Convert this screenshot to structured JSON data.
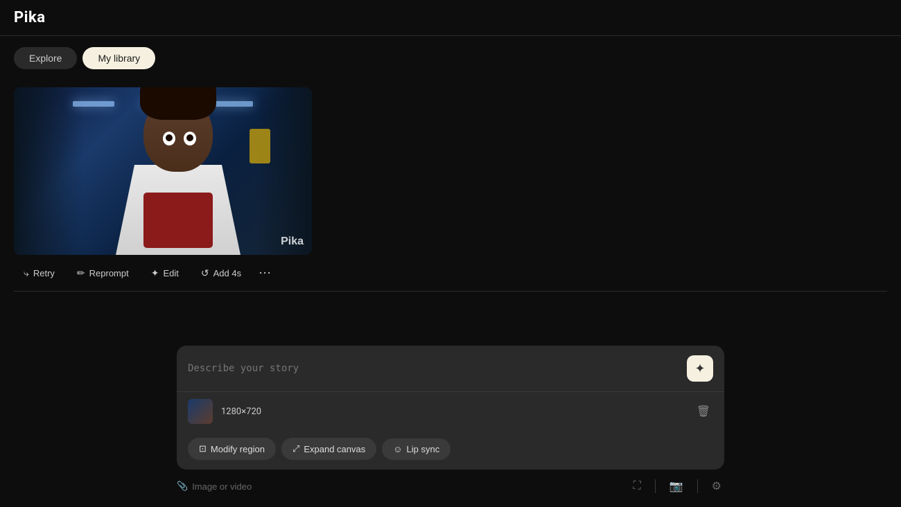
{
  "app": {
    "logo": "Pika"
  },
  "nav": {
    "explore_label": "Explore",
    "library_label": "My library",
    "active_tab": "library"
  },
  "video": {
    "watermark": "Pika",
    "dimensions": "1280×720"
  },
  "action_bar": {
    "retry_label": "Retry",
    "reprompt_label": "Reprompt",
    "edit_label": "Edit",
    "add4s_label": "Add 4s",
    "more_dots": "•••"
  },
  "input": {
    "placeholder": "Describe your story",
    "generate_icon": "✦",
    "image_dims": "1280×720"
  },
  "tools": {
    "modify_region_label": "Modify region",
    "expand_canvas_label": "Expand canvas",
    "lip_sync_label": "Lip sync"
  },
  "footer": {
    "attach_label": "Image or video"
  },
  "icons": {
    "retry": "⤷",
    "reprompt": "✏",
    "edit": "✦",
    "add4s": "↺",
    "more": "⋯",
    "generate": "✦",
    "delete": "🗑",
    "modify_region": "⊡",
    "expand_canvas": "⤢",
    "lip_sync": "☺",
    "attach": "📎",
    "fullscreen": "⛶",
    "camera": "📷",
    "settings": "⚙"
  }
}
